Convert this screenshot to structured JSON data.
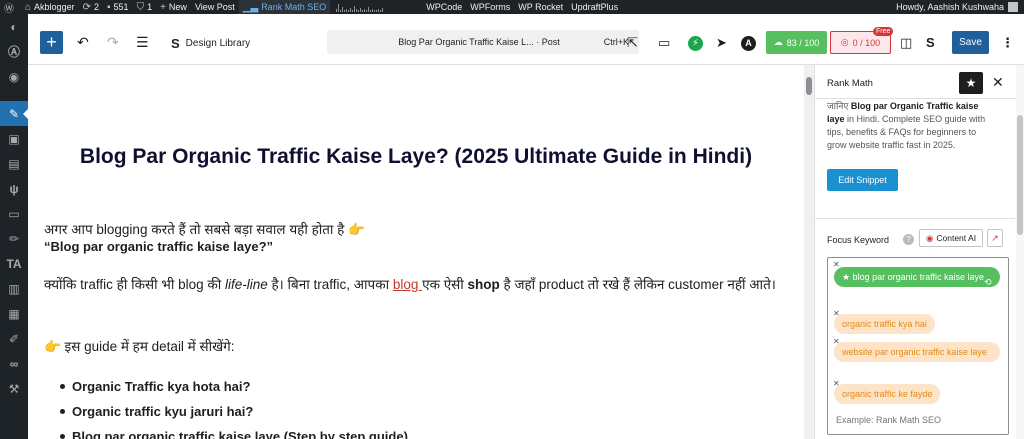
{
  "admin_bar": {
    "site_name": "Akblogger",
    "updates_count": "2",
    "comments_count": "551",
    "notifications_count": "1",
    "new_label": "New",
    "view_post_label": "View Post",
    "rank_math_label": "Rank Math SEO",
    "menu_items": [
      "WPCode",
      "WPForms",
      "WP Rocket",
      "UpdraftPlus"
    ],
    "howdy_text": "Howdy, Aashish Kushwaha"
  },
  "left_menu": {
    "icons": [
      "dashboard-icon",
      "astra-icon",
      "updates-icon",
      "posts-icon",
      "media-icon",
      "pages-icon",
      "comments-icon",
      "appearance-icon",
      "plugins-icon",
      "users-icon",
      "tools-icon",
      "settings-icon"
    ],
    "active_icon": "posts-icon"
  },
  "toolbar": {
    "add_label": "+",
    "design_library_label": "Design Library",
    "command_title": "Blog Par Organic Traffic Kaise L... · Post",
    "command_shortcut": "Ctrl+K",
    "seo_score": "83 / 100",
    "readability_score": "0 / 100",
    "free_badge": "Free",
    "save_label": "Save"
  },
  "content": {
    "title": "Blog Par Organic Traffic Kaise Laye? (2025 Ultimate Guide in Hindi)",
    "intro_text": "अगर आप blogging करते हैं तो सबसे बड़ा सवाल यही होता है 👉",
    "intro_question": "“Blog par organic traffic kaise laye?”",
    "para2_part1": "क्योंकि traffic ही किसी भी blog की ",
    "para2_italic": "life-line",
    "para2_part2": " है। बिना traffic, आपका ",
    "para2_link": "blog ",
    "para2_part3": "एक ऐसी ",
    "para2_bold": "shop",
    "para2_part4": " है जहाँ product तो रखे हैं लेकिन customer नहीं आते।",
    "para3": "👉 इस guide में हम detail में सीखेंगे:",
    "list": [
      "Organic Traffic kya hota hai?",
      "Organic traffic kyu jaruri hai?",
      "Blog par organic traffic kaise laye (Step by step guide)"
    ]
  },
  "sidebar": {
    "title": "Rank Math",
    "desc_prefix": "जानिए ",
    "desc_bold": "Blog par Organic Traffic kaise laye",
    "desc_rest": " in Hindi. Complete SEO guide with tips, benefits & FAQs for beginners to grow website traffic fast in 2025.",
    "edit_snippet_label": "Edit Snippet",
    "focus_keyword_label": "Focus Keyword",
    "content_ai_label": "Content AI",
    "keywords": [
      "blog par organic traffic kaise laye",
      "organic traffic kya hai",
      "website par organic traffic kaise laye",
      "organic traffic ke fayde"
    ],
    "keyword_placeholder": "Example: Rank Math SEO"
  },
  "colors": {
    "admin_bar_bg": "#1d2327",
    "primary_blue": "#1e5f9c",
    "seo_green": "#56bf5f",
    "readability_red": "#d63638",
    "keyword_orange": "#e58a16",
    "keyword_orange_bg": "#fde4c8"
  }
}
